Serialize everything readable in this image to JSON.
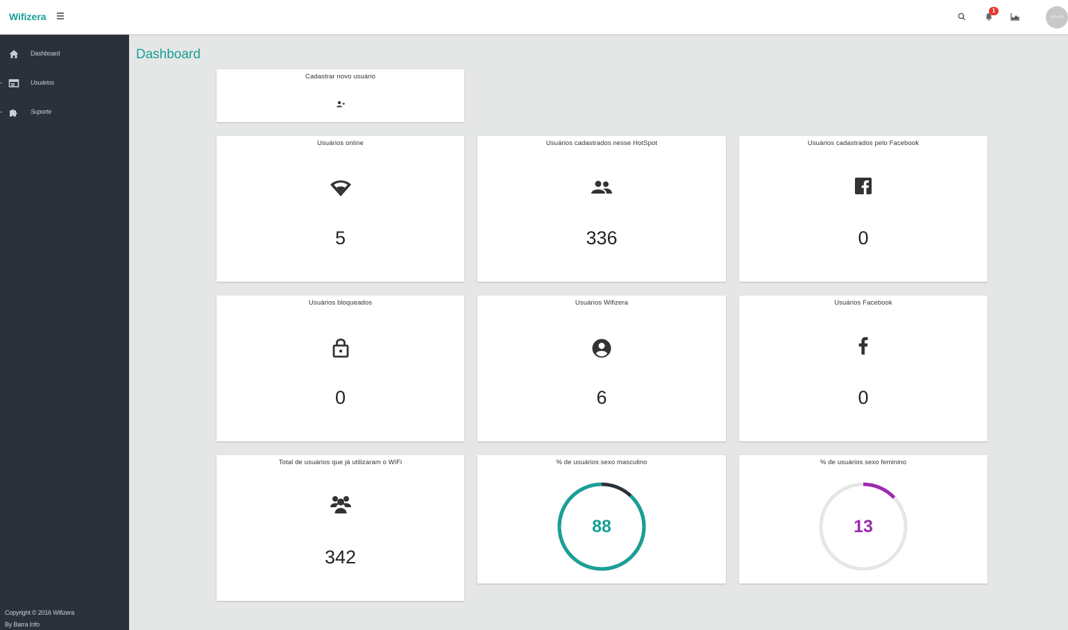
{
  "app": {
    "brand": "Wifizera",
    "avatar_text": "140x140",
    "notification_count": "1",
    "top_icons": [
      "search-icon",
      "bell-icon",
      "area-chart-icon"
    ]
  },
  "sidebar": {
    "items": [
      {
        "label": "Dashboard",
        "icon": "home-icon"
      },
      {
        "label": "Usuários",
        "icon": "list-icon"
      },
      {
        "label": "Suporte",
        "icon": "puzzle-icon"
      }
    ],
    "footer": {
      "copyright": "Copyright © 2016 Wifizera",
      "by": "By Barra Info"
    }
  },
  "page": {
    "title": "Dashboard"
  },
  "cards": {
    "new_user": {
      "title": "Cadastrar novo usuário",
      "icon": "add-user-icon"
    },
    "online": {
      "title": "Usuários online",
      "value": "5",
      "icon": "wifi-icon"
    },
    "hotspot": {
      "title": "Usuários cadastrados nesse HotSpot",
      "value": "336",
      "icon": "people-icon"
    },
    "facebook_registered": {
      "title": "Usuários cadastrados pelo Facebook",
      "value": "0",
      "icon": "facebook-square-icon"
    },
    "blocked": {
      "title": "Usuários bloqueados",
      "value": "0",
      "icon": "lock-icon"
    },
    "wifizera": {
      "title": "Usuários Wifizera",
      "value": "6",
      "icon": "account-circle-icon"
    },
    "facebook": {
      "title": "Usuários Facebook",
      "value": "0",
      "icon": "facebook-f-icon"
    },
    "total": {
      "title": "Total de usuários que já utilizaram o WiFi",
      "value": "342",
      "icon": "group-icon"
    },
    "male": {
      "title": "% de usuários sexo masculino",
      "value": "88",
      "percent": 88,
      "color": "#17a098",
      "remainder_color": "#2a313a"
    },
    "female": {
      "title": "% de usuários sexo feminino",
      "value": "13",
      "percent": 13,
      "color": "#9c27b0",
      "remainder_color": "#e6e6e6"
    }
  },
  "colors": {
    "accent": "#17a098",
    "sidebar": "#2a313a",
    "badge": "#e53935",
    "female": "#9c27b0"
  }
}
